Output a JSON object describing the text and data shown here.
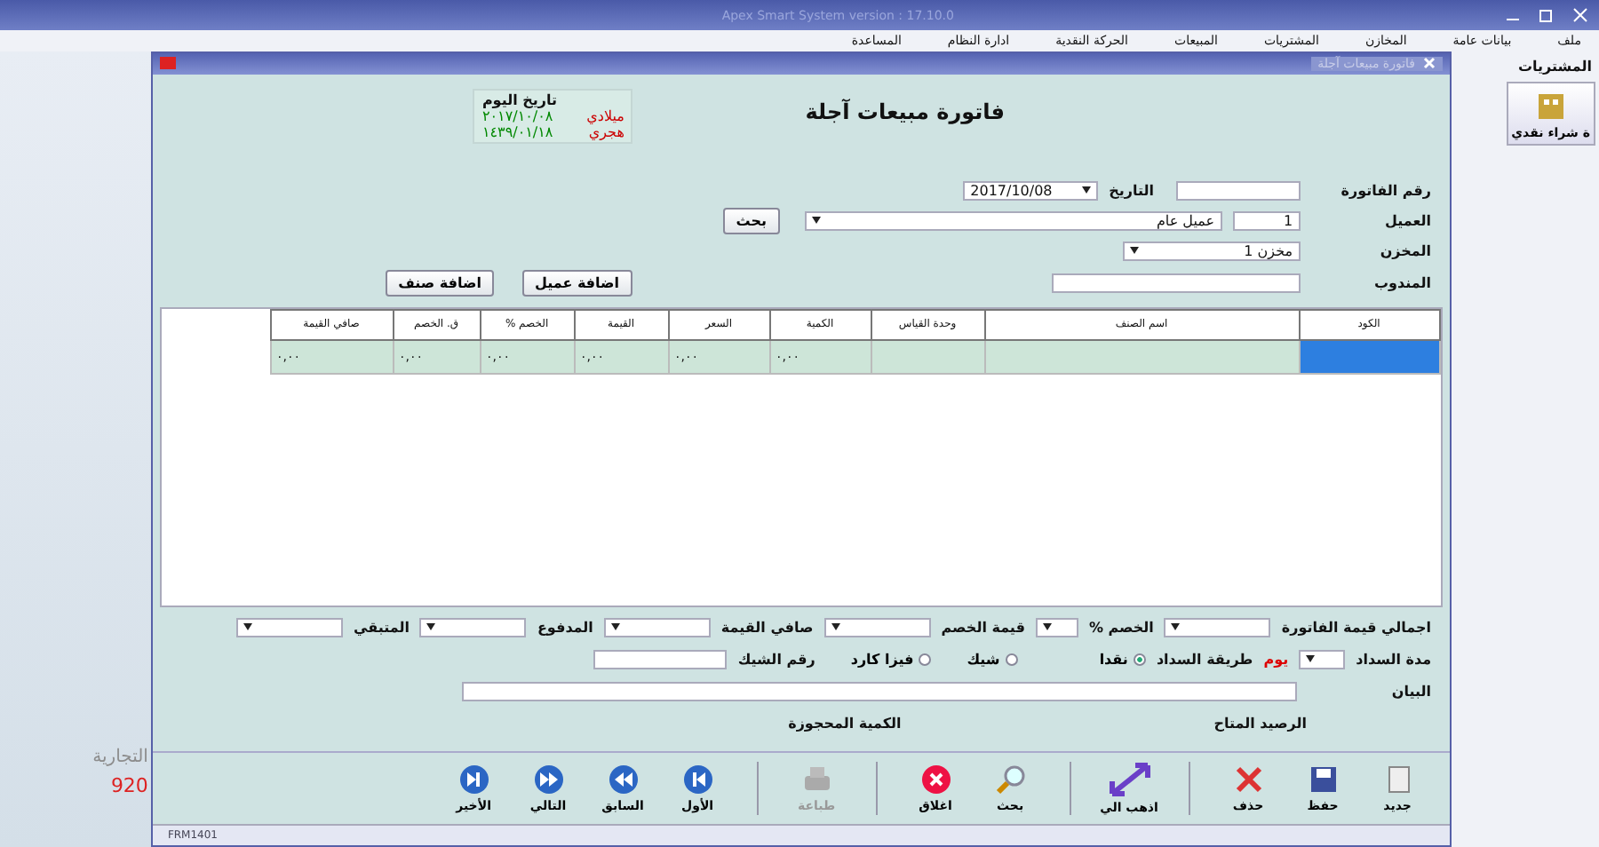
{
  "app_window": {
    "title": "Apex Smart System version : 17.10.0"
  },
  "menu_bar": {
    "items": [
      "ملف",
      "بيانات عامة",
      "المخازن",
      "المشتريات",
      "المبيعات",
      "الحركة النقدية",
      "ادارة النظام",
      "المساعدة"
    ]
  },
  "desktop": {
    "texts": [
      {
        "text": "التجارية",
        "kind": "name"
      },
      {
        "text": "920",
        "kind": "phone"
      }
    ]
  },
  "side_panel": {
    "title": "المشتريات",
    "shortcut": "ة شراء نقدي"
  },
  "invoice_window": {
    "tab_title": "فاتورة مبيعات آجلة",
    "title": "فاتورة مبيعات آجلة",
    "today": {
      "label": "تاريخ اليوم",
      "rows": [
        {
          "label": "ميلادي",
          "value": "٢٠١٧/١٠/٠٨"
        },
        {
          "label": "هجري",
          "value": "١٤٣٩/٠١/١٨"
        }
      ]
    },
    "fields": {
      "invoice_number_label": "رقم الفاتورة",
      "date_label": "التاريخ",
      "date": "2017/10/08",
      "customer_label": "العميل",
      "customer_code": "1",
      "customer_name": "عميل عام",
      "search_button": "بحث",
      "store_label": "المخزن",
      "store": "مخزن 1",
      "rep_label": "المندوب",
      "add_customer_button": "اضافة عميل",
      "add_item_button": "اضافة صنف"
    },
    "table": {
      "columns": [
        "الكود",
        "اسم الصنف",
        "وحدة القياس",
        "الكمية",
        "السعر",
        "القيمة",
        "الخصم %",
        "ق. الخصم",
        "صافي القيمة"
      ],
      "rows": [
        {
          "cells": [
            {
              "selected": true
            },
            {
              "selected": false
            },
            {
              "selected": false
            },
            {
              "selected": false,
              "text": "٠,٠٠"
            },
            {
              "selected": false,
              "text": "٠,٠٠"
            },
            {
              "selected": false,
              "text": "٠,٠٠"
            },
            {
              "selected": false,
              "text": "٠,٠٠"
            },
            {
              "selected": false,
              "text": "٠,٠٠"
            },
            {
              "selected": false,
              "text": "٠,٠٠"
            }
          ]
        }
      ]
    },
    "totals": [
      "اجمالي قيمة الفاتورة",
      "الخصم %",
      "قيمة الخصم",
      "صافي القيمة",
      "المدفوع",
      "المتبقي"
    ],
    "payment": {
      "period_label": "مدة السداد",
      "unit": "يوم",
      "method_label": "طريقة السداد",
      "methods": [
        {
          "label": "نقدا",
          "selected": true
        },
        {
          "label": "شيك",
          "selected": false
        },
        {
          "label": "فيزا كارد",
          "selected": false
        }
      ],
      "cheque_label": "رقم الشيك"
    },
    "statement_label": "البيان",
    "available_balance_label": "الرصيد المتاح",
    "reserved_quantity_label": "الكمية المحجوزة",
    "toolbar": [
      {
        "label": "جديد",
        "kind": "new",
        "disabled": false
      },
      {
        "label": "حفظ",
        "kind": "save",
        "disabled": false
      },
      {
        "label": "حذف",
        "kind": "delete",
        "disabled": false
      },
      {
        "label": "اذهب الي",
        "kind": "goto",
        "disabled": false
      },
      {
        "label": "بحث",
        "kind": "search",
        "disabled": false
      },
      {
        "label": "اغلاق",
        "kind": "close",
        "disabled": false
      },
      {
        "label": "طباعة",
        "kind": "print",
        "disabled": true
      },
      {
        "label": "الأول",
        "kind": "first",
        "disabled": false
      },
      {
        "label": "السابق",
        "kind": "prev",
        "disabled": false
      },
      {
        "label": "التالي",
        "kind": "next",
        "disabled": false
      },
      {
        "label": "الأخير",
        "kind": "last",
        "disabled": false
      }
    ],
    "status_bar": "FRM1401"
  }
}
